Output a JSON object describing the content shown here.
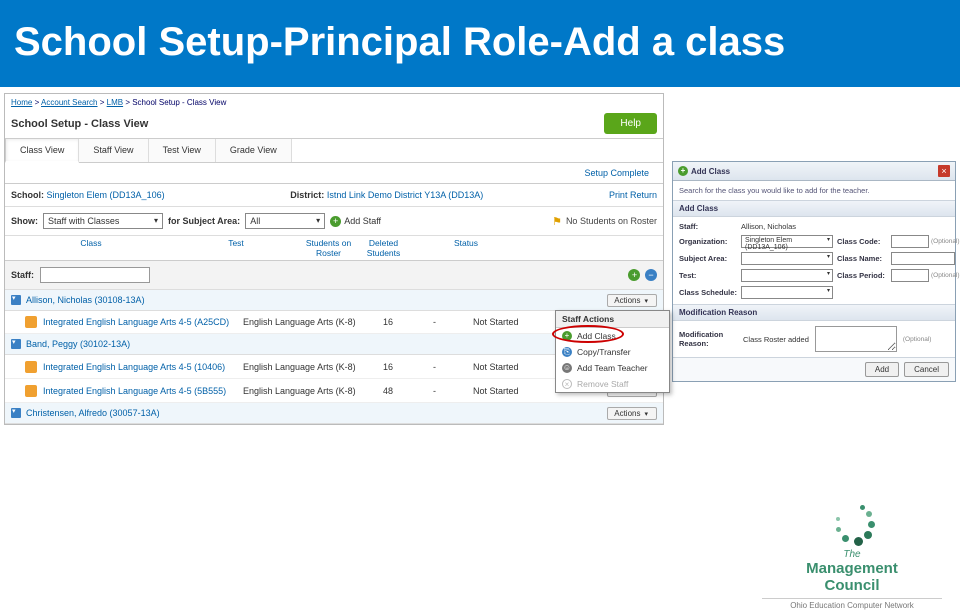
{
  "banner": "School Setup-Principal Role-Add a class",
  "breadcrumb": [
    "Home",
    "Account Search",
    "LMB",
    "School Setup - Class View"
  ],
  "page_title": "School Setup - Class View",
  "help": "Help",
  "tabs": [
    "Class View",
    "Staff View",
    "Test View",
    "Grade View"
  ],
  "setup_link": "Setup Complete",
  "school": {
    "label": "School:",
    "value": "Singleton Elem (DD13A_106)"
  },
  "district": {
    "label": "District:",
    "value": "Istnd Link Demo District Y13A (DD13A)"
  },
  "right_links": [
    "Print",
    "Return"
  ],
  "show": {
    "label": "Show:",
    "value": "Staff with Classes",
    "subject_label": "for Subject Area:",
    "subject_value": "All"
  },
  "add_staff": "Add Staff",
  "no_roster": "No Students on Roster",
  "columns": {
    "class": "Class",
    "test": "Test",
    "sr": "Students on Roster",
    "ds": "Deleted Students",
    "status": "Status"
  },
  "staff_bar_label": "Staff:",
  "groups": [
    {
      "name": "Allison, Nicholas (30108-13A)",
      "rows": [
        {
          "class": "Integrated English Language Arts 4-5 (A25CD)",
          "test": "English Language Arts (K-8)",
          "sr": "16",
          "ds": "-",
          "status": "Not Started"
        }
      ]
    },
    {
      "name": "Band, Peggy (30102-13A)",
      "rows": [
        {
          "class": "Integrated English Language Arts 4-5 (10406)",
          "test": "English Language Arts (K-8)",
          "sr": "16",
          "ds": "-",
          "status": "Not Started"
        },
        {
          "class": "Integrated English Language Arts 4-5 (5B555)",
          "test": "English Language Arts (K-8)",
          "sr": "48",
          "ds": "-",
          "status": "Not Started"
        }
      ]
    },
    {
      "name": "Christensen, Alfredo (30057-13A)",
      "rows": []
    }
  ],
  "actions_label": "Actions",
  "actions_menu": {
    "header": "Staff Actions",
    "add": "Add Class",
    "copy": "Copy/Transfer",
    "team": "Add Team Teacher",
    "remove": "Remove Staff"
  },
  "modal": {
    "title": "Add Class",
    "note": "Search for the class you would like to add for the teacher.",
    "section": "Add Class",
    "fields": {
      "staff": {
        "label": "Staff:",
        "value": "Allison, Nicholas"
      },
      "org": {
        "label": "Organization:",
        "value": "Singleton Elem (DD13A_106)"
      },
      "subj": {
        "label": "Subject Area:",
        "value": ""
      },
      "test": {
        "label": "Test:",
        "value": ""
      },
      "sched": {
        "label": "Class Schedule:",
        "value": ""
      },
      "code": {
        "label": "Class Code:",
        "opt": "(Optional)"
      },
      "cname": {
        "label": "Class Name:",
        "opt": ""
      },
      "period": {
        "label": "Class Period:",
        "opt": "(Optional)"
      }
    },
    "reason_section": "Modification Reason",
    "reason_label": "Modification Reason:",
    "reason_value": "Class Roster added",
    "reason_opt": "(Optional)",
    "add_btn": "Add",
    "cancel_btn": "Cancel"
  },
  "logo": {
    "line1": "The",
    "line2": "Management",
    "line3": "Council",
    "sub": "Ohio Education Computer Network"
  }
}
